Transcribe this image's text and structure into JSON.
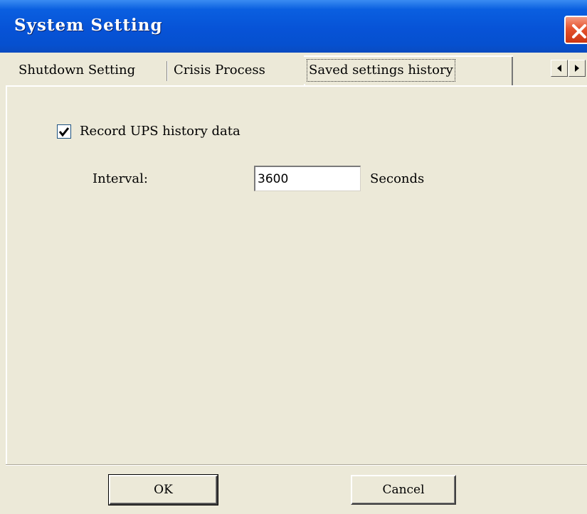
{
  "window": {
    "title": "System Setting",
    "close_icon": "close-icon"
  },
  "tabs": [
    {
      "label": "Shutdown Setting"
    },
    {
      "label": "Crisis Process"
    },
    {
      "label": "Saved settings history",
      "selected": true
    }
  ],
  "tab_scroll": {
    "left_icon": "tab-scroll-left-icon",
    "right_icon": "tab-scroll-right-icon"
  },
  "history": {
    "record_label": "Record UPS history data",
    "record_checked": true,
    "interval_label": "Interval:",
    "interval_value": "3600",
    "interval_unit": "Seconds"
  },
  "buttons": {
    "ok_label": "OK",
    "cancel_label": "Cancel"
  },
  "colors": {
    "titlebar": "#0753d7",
    "face": "#ece9d8",
    "close": "#e4532e"
  }
}
